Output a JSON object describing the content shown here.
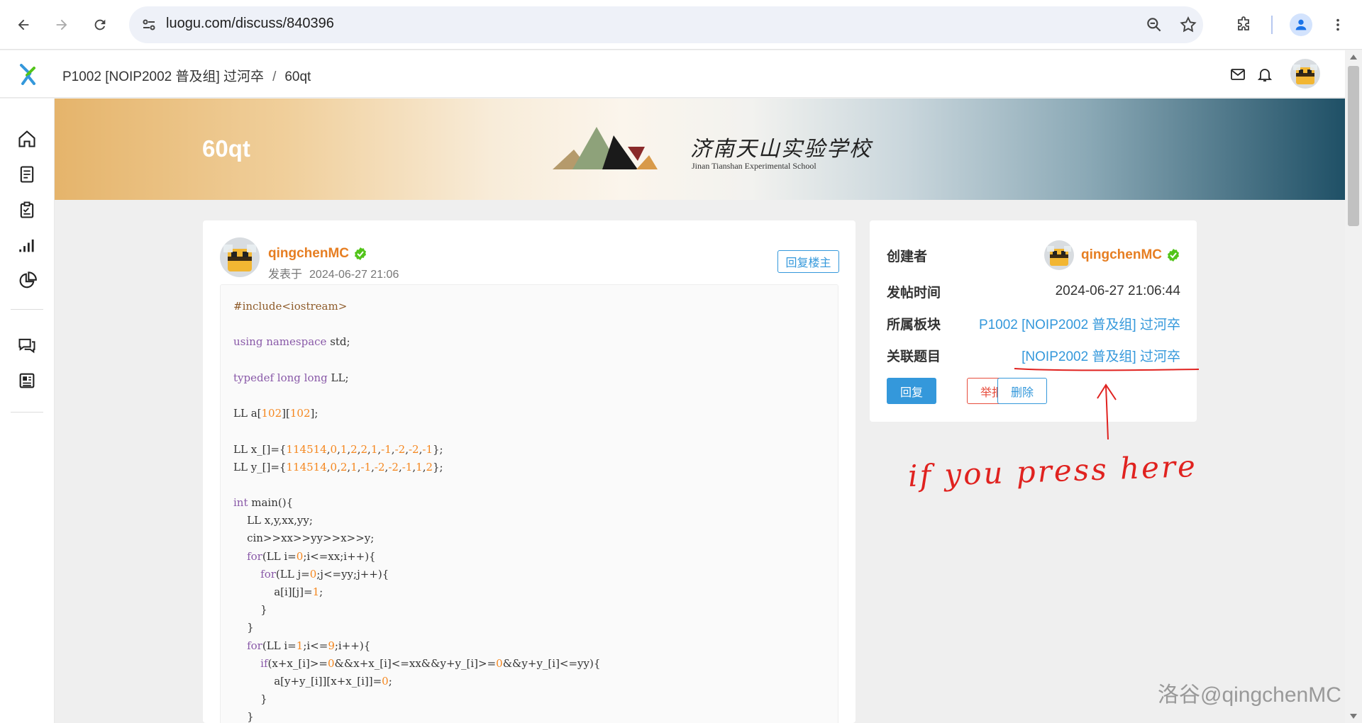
{
  "browser": {
    "url": "luogu.com/discuss/840396"
  },
  "header": {
    "breadcrumb_problem": "P1002 [NOIP2002 普及组] 过河卒",
    "breadcrumb_sep": "/",
    "breadcrumb_post": "60qt"
  },
  "banner": {
    "title": "60qt",
    "school_name": "济南天山实验学校",
    "school_en": "Jinan Tianshan Experimental School"
  },
  "post": {
    "author": "qingchenMC",
    "posted_prefix": "发表于",
    "posted_time": "2024-06-27 21:06",
    "reply_owner_label": "回复楼主"
  },
  "code": [
    [
      [
        "pre",
        "#include<iostream>"
      ]
    ],
    [],
    [
      [
        "kw",
        "using"
      ],
      [
        "t",
        " "
      ],
      [
        "kw",
        "namespace"
      ],
      [
        "t",
        " std;"
      ]
    ],
    [],
    [
      [
        "kw",
        "typedef"
      ],
      [
        "t",
        " "
      ],
      [
        "kw",
        "long long"
      ],
      [
        "t",
        " LL;"
      ]
    ],
    [],
    [
      [
        "t",
        "LL a["
      ],
      [
        "num",
        "102"
      ],
      [
        "t",
        "]["
      ],
      [
        "num",
        "102"
      ],
      [
        "t",
        "];"
      ]
    ],
    [],
    [
      [
        "t",
        "LL x_[]={"
      ],
      [
        "num",
        "114514"
      ],
      [
        "t",
        ","
      ],
      [
        "num",
        "0"
      ],
      [
        "t",
        ","
      ],
      [
        "num",
        "1"
      ],
      [
        "t",
        ","
      ],
      [
        "num",
        "2"
      ],
      [
        "t",
        ","
      ],
      [
        "num",
        "2"
      ],
      [
        "t",
        ","
      ],
      [
        "num",
        "1"
      ],
      [
        "t",
        ","
      ],
      [
        "num",
        "-1"
      ],
      [
        "t",
        ","
      ],
      [
        "num",
        "-2"
      ],
      [
        "t",
        ","
      ],
      [
        "num",
        "-2"
      ],
      [
        "t",
        ","
      ],
      [
        "num",
        "-1"
      ],
      [
        "t",
        "};"
      ]
    ],
    [
      [
        "t",
        "LL y_[]={"
      ],
      [
        "num",
        "114514"
      ],
      [
        "t",
        ","
      ],
      [
        "num",
        "0"
      ],
      [
        "t",
        ","
      ],
      [
        "num",
        "2"
      ],
      [
        "t",
        ","
      ],
      [
        "num",
        "1"
      ],
      [
        "t",
        ","
      ],
      [
        "num",
        "-1"
      ],
      [
        "t",
        ","
      ],
      [
        "num",
        "-2"
      ],
      [
        "t",
        ","
      ],
      [
        "num",
        "-2"
      ],
      [
        "t",
        ","
      ],
      [
        "num",
        "-1"
      ],
      [
        "t",
        ","
      ],
      [
        "num",
        "1"
      ],
      [
        "t",
        ","
      ],
      [
        "num",
        "2"
      ],
      [
        "t",
        "};"
      ]
    ],
    [],
    [
      [
        "kw",
        "int"
      ],
      [
        "t",
        " main(){"
      ]
    ],
    [
      [
        "t",
        "    LL x,y,xx,yy;"
      ]
    ],
    [
      [
        "t",
        "    cin>>xx>>yy>>x>>y;"
      ]
    ],
    [
      [
        "t",
        "    "
      ],
      [
        "kw",
        "for"
      ],
      [
        "t",
        "(LL i="
      ],
      [
        "num",
        "0"
      ],
      [
        "t",
        ";i<=xx;i++){"
      ]
    ],
    [
      [
        "t",
        "        "
      ],
      [
        "kw",
        "for"
      ],
      [
        "t",
        "(LL j="
      ],
      [
        "num",
        "0"
      ],
      [
        "t",
        ";j<=yy;j++){"
      ]
    ],
    [
      [
        "t",
        "            a[i][j]="
      ],
      [
        "num",
        "1"
      ],
      [
        "t",
        ";"
      ]
    ],
    [
      [
        "t",
        "        }"
      ]
    ],
    [
      [
        "t",
        "    }"
      ]
    ],
    [
      [
        "t",
        "    "
      ],
      [
        "kw",
        "for"
      ],
      [
        "t",
        "(LL i="
      ],
      [
        "num",
        "1"
      ],
      [
        "t",
        ";i<="
      ],
      [
        "num",
        "9"
      ],
      [
        "t",
        ";i++){"
      ]
    ],
    [
      [
        "t",
        "        "
      ],
      [
        "kw",
        "if"
      ],
      [
        "t",
        "(x+x_[i]>="
      ],
      [
        "num",
        "0"
      ],
      [
        "t",
        "&&x+x_[i]<=xx&&y+y_[i]>="
      ],
      [
        "num",
        "0"
      ],
      [
        "t",
        "&&y+y_[i]<=yy){"
      ]
    ],
    [
      [
        "t",
        "            a[y+y_[i]][x+x_[i]]="
      ],
      [
        "num",
        "0"
      ],
      [
        "t",
        ";"
      ]
    ],
    [
      [
        "t",
        "        }"
      ]
    ],
    [
      [
        "t",
        "    }"
      ]
    ]
  ],
  "info": {
    "creator_label": "创建者",
    "creator": "qingchenMC",
    "post_time_label": "发帖时间",
    "post_time": "2024-06-27 21:06:44",
    "board_label": "所属板块",
    "board": "P1002 [NOIP2002 普及组] 过河卒",
    "related_label": "关联题目",
    "related": "[NOIP2002 普及组] 过河卒",
    "reply_btn": "回复",
    "report_btn": "举报",
    "delete_btn": "删除"
  },
  "annotation": {
    "text": "if you press here"
  },
  "watermark": "洛谷@qingchenMC",
  "colors": {
    "accent_blue": "#3498db",
    "author_orange": "#e67e22",
    "danger_red": "#e74c3c",
    "annotation_red": "#e0221f"
  }
}
